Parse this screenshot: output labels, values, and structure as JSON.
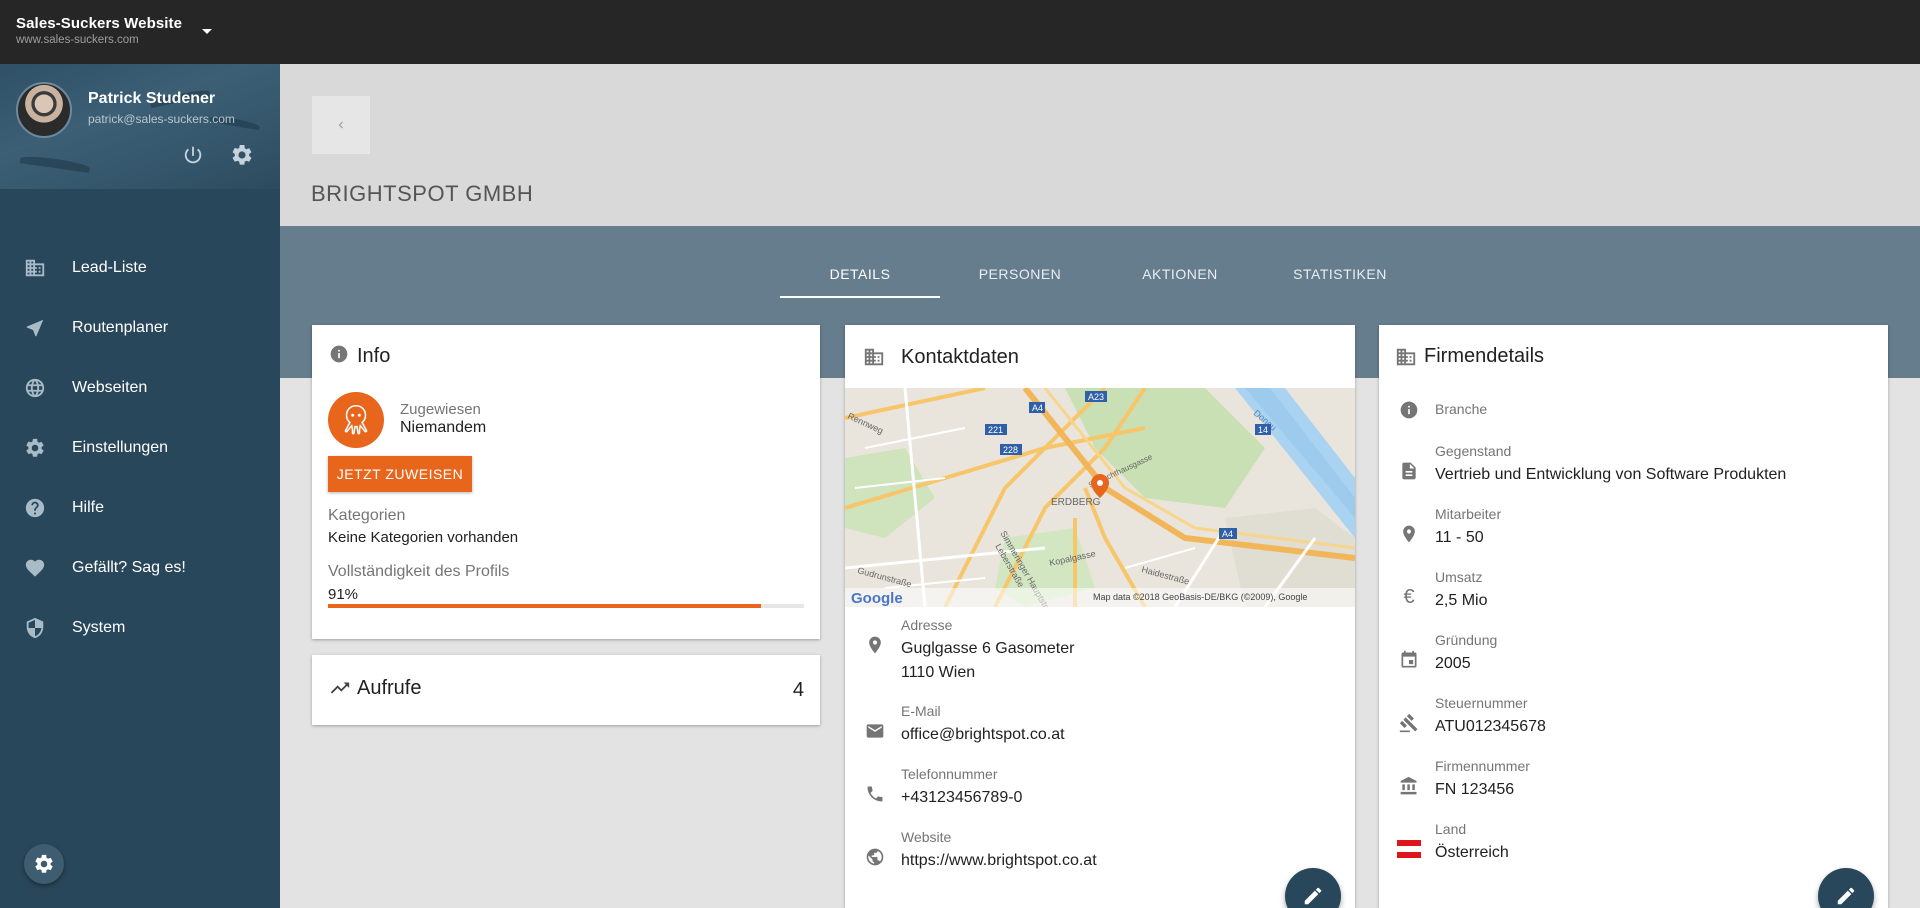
{
  "topbar": {
    "site_title": "Sales-Suckers Website",
    "site_url": "www.sales-suckers.com"
  },
  "user": {
    "name": "Patrick Studener",
    "email": "patrick@sales-suckers.com"
  },
  "nav": [
    {
      "label": "Lead-Liste",
      "icon": "building-icon"
    },
    {
      "label": "Routenplaner",
      "icon": "navigation-arrow-icon"
    },
    {
      "label": "Webseiten",
      "icon": "globe-icon"
    },
    {
      "label": "Einstellungen",
      "icon": "gear-icon"
    },
    {
      "label": "Hilfe",
      "icon": "help-icon"
    },
    {
      "label": "Gefällt? Sag es!",
      "icon": "heart-icon"
    },
    {
      "label": "System",
      "icon": "shield-icon"
    }
  ],
  "page": {
    "title": "BRIGHTSPOT GMBH"
  },
  "tabs": [
    {
      "label": "DETAILS",
      "active": true
    },
    {
      "label": "PERSONEN",
      "active": false
    },
    {
      "label": "AKTIONEN",
      "active": false
    },
    {
      "label": "STATISTIKEN",
      "active": false
    }
  ],
  "info": {
    "title": "Info",
    "assigned_label": "Zugewiesen",
    "assigned_value": "Niemandem",
    "assign_button": "JETZT ZUWEISEN",
    "categories_label": "Kategorien",
    "categories_value": "Keine Kategorien vorhanden",
    "completeness_label": "Vollständigkeit des Profils",
    "completeness_text": "91%",
    "completeness_value": 0.91
  },
  "views": {
    "title": "Aufrufe",
    "count": "4"
  },
  "contact": {
    "title": "Kontaktdaten",
    "map_attribution": "Map data ©2018 GeoBasis-DE/BKG (©2009), Google",
    "map_logo": "Google",
    "map_labels": [
      "A23",
      "A4",
      "221",
      "228",
      "ERDBERG",
      "Rennweg",
      "Donau",
      "14",
      "A4",
      "Haidestraße",
      "Kopalgasse",
      "Gudrunstraße",
      "Simmeringer Hauptstr.",
      "Leberstraße",
      "Schlachthausgasse"
    ],
    "address_label": "Adresse",
    "address_line1": "Guglgasse 6 Gasometer",
    "address_line2": "1110 Wien",
    "email_label": "E-Mail",
    "email_value": "office@brightspot.co.at",
    "phone_label": "Telefonnummer",
    "phone_value": "+43123456789-0",
    "website_label": "Website",
    "website_value": "https://www.brightspot.co.at"
  },
  "company": {
    "title": "Firmendetails",
    "rows": [
      {
        "label": "Branche",
        "value": "",
        "icon": "info-icon"
      },
      {
        "label": "Gegenstand",
        "value": "Vertrieb und Entwicklung von Software Produkten",
        "icon": "document-icon"
      },
      {
        "label": "Mitarbeiter",
        "value": "11 - 50",
        "icon": "location-pin-icon"
      },
      {
        "label": "Umsatz",
        "value": "2,5 Mio",
        "icon": "euro-icon"
      },
      {
        "label": "Gründung",
        "value": "2005",
        "icon": "calendar-icon"
      },
      {
        "label": "Steuernummer",
        "value": "ATU012345678",
        "icon": "gavel-icon"
      },
      {
        "label": "Firmennummer",
        "value": "FN 123456",
        "icon": "bank-icon"
      },
      {
        "label": "Land",
        "value": "Österreich",
        "icon": "austria-flag-icon"
      }
    ]
  },
  "colors": {
    "accent": "#e8661c",
    "sidebar": "#29475a",
    "topbar": "#262626",
    "tab_band": "#667d8d"
  }
}
